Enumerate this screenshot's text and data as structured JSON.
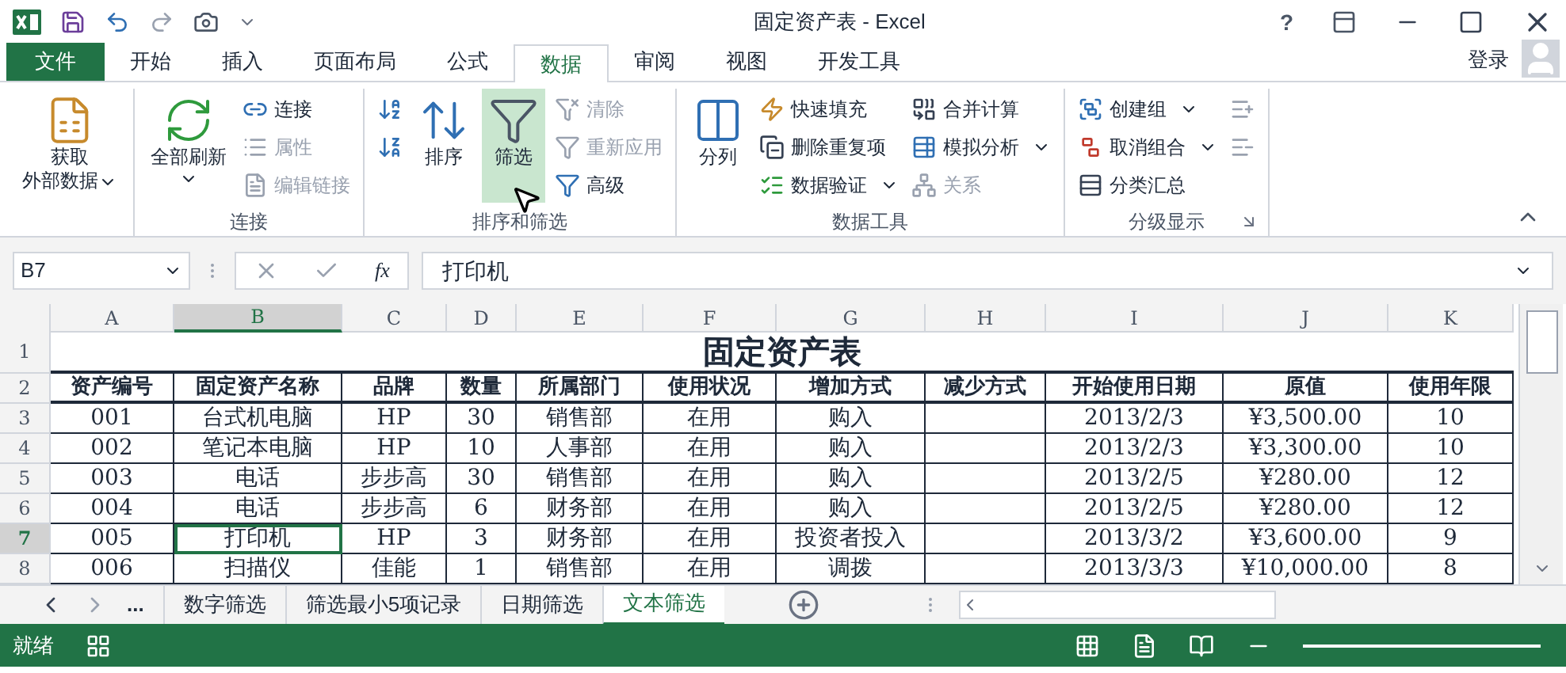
{
  "window": {
    "title": "固定资产表 - Excel",
    "help_label": "?"
  },
  "tabs": [
    {
      "label": "文件",
      "kind": "file",
      "selected": false
    },
    {
      "label": "开始",
      "kind": "tab",
      "selected": false
    },
    {
      "label": "插入",
      "kind": "tab",
      "selected": false
    },
    {
      "label": "页面布局",
      "kind": "tab",
      "selected": false
    },
    {
      "label": "公式",
      "kind": "tab",
      "selected": false
    },
    {
      "label": "数据",
      "kind": "tab",
      "selected": true
    },
    {
      "label": "审阅",
      "kind": "tab",
      "selected": false
    },
    {
      "label": "视图",
      "kind": "tab",
      "selected": false
    },
    {
      "label": "开发工具",
      "kind": "tab",
      "selected": false
    }
  ],
  "account": {
    "label": "登录"
  },
  "ribbon": {
    "groups": [
      {
        "columns": [
          {
            "kind": "large",
            "items": [
              {
                "lines": [
                  "获取",
                  "外部数据"
                ],
                "dropdown": true,
                "disabled": false,
                "highlighted": false
              }
            ]
          }
        ]
      },
      {
        "label": "连接",
        "columns": [
          {
            "kind": "large",
            "items": [
              {
                "lines": [
                  "全部刷新"
                ],
                "dropdown": true,
                "disabled": false,
                "highlighted": false
              }
            ]
          },
          {
            "kind": "stack",
            "items": [
              {
                "label": "连接",
                "dropdown": false,
                "disabled": false,
                "highlighted": false
              },
              {
                "label": "属性",
                "dropdown": false,
                "disabled": true,
                "highlighted": false
              },
              {
                "label": "编辑链接",
                "dropdown": false,
                "disabled": true,
                "highlighted": false
              }
            ]
          }
        ]
      },
      {
        "label": "排序和筛选",
        "columns": [
          {
            "kind": "stack",
            "items": [
              {
                "dropdown": false,
                "disabled": false,
                "highlighted": false
              },
              {
                "dropdown": false,
                "disabled": false,
                "highlighted": false
              }
            ]
          },
          {
            "kind": "large",
            "items": [
              {
                "lines": [
                  "排序"
                ],
                "dropdown": false,
                "disabled": false,
                "highlighted": false
              }
            ]
          },
          {
            "kind": "large",
            "items": [
              {
                "lines": [
                  "筛选"
                ],
                "dropdown": false,
                "disabled": false,
                "highlighted": true
              }
            ]
          },
          {
            "kind": "stack",
            "items": [
              {
                "label": "清除",
                "dropdown": false,
                "disabled": true,
                "highlighted": false
              },
              {
                "label": "重新应用",
                "dropdown": false,
                "disabled": true,
                "highlighted": false
              },
              {
                "label": "高级",
                "dropdown": false,
                "disabled": false,
                "highlighted": false
              }
            ]
          }
        ]
      },
      {
        "label": "数据工具",
        "columns": [
          {
            "kind": "large",
            "items": [
              {
                "lines": [
                  "分列"
                ],
                "dropdown": false,
                "disabled": false,
                "highlighted": false
              }
            ]
          },
          {
            "kind": "stack",
            "items": [
              {
                "label": "快速填充",
                "dropdown": false,
                "disabled": false,
                "highlighted": false
              },
              {
                "label": "删除重复项",
                "dropdown": false,
                "disabled": false,
                "highlighted": false
              },
              {
                "label": "数据验证",
                "dropdown": true,
                "disabled": false,
                "highlighted": false
              }
            ]
          },
          {
            "kind": "stack",
            "items": [
              {
                "label": "合并计算",
                "dropdown": false,
                "disabled": false,
                "highlighted": false
              },
              {
                "label": "模拟分析",
                "dropdown": true,
                "disabled": false,
                "highlighted": false
              },
              {
                "label": "关系",
                "dropdown": false,
                "disabled": true,
                "highlighted": false
              }
            ]
          }
        ]
      },
      {
        "label": "分级显示",
        "launcher": true,
        "columns": [
          {
            "kind": "stack",
            "items": [
              {
                "label": "创建组",
                "dropdown": true,
                "disabled": false,
                "highlighted": false
              },
              {
                "label": "取消组合",
                "dropdown": true,
                "disabled": false,
                "highlighted": false
              },
              {
                "label": "分类汇总",
                "dropdown": false,
                "disabled": false,
                "highlighted": false
              }
            ]
          },
          {
            "kind": "stack",
            "items": [
              {
                "dropdown": false,
                "disabled": true,
                "highlighted": false
              },
              {
                "dropdown": false,
                "disabled": true,
                "highlighted": false
              }
            ]
          }
        ]
      }
    ]
  },
  "formula_bar": {
    "name_box": "B7",
    "function_label": "fx",
    "value": "打印机"
  },
  "sheet": {
    "columns": [
      {
        "label": "A",
        "selected": false
      },
      {
        "label": "B",
        "selected": true
      },
      {
        "label": "C",
        "selected": false
      },
      {
        "label": "D",
        "selected": false
      },
      {
        "label": "E",
        "selected": false
      },
      {
        "label": "F",
        "selected": false
      },
      {
        "label": "G",
        "selected": false
      },
      {
        "label": "H",
        "selected": false
      },
      {
        "label": "I",
        "selected": false
      },
      {
        "label": "J",
        "selected": false
      },
      {
        "label": "K",
        "selected": false
      }
    ],
    "title_row": {
      "number": "1",
      "title": "固定资产表"
    },
    "header_row": {
      "number": "2",
      "cells": [
        "资产编号",
        "固定资产名称",
        "品牌",
        "数量",
        "所属部门",
        "使用状况",
        "增加方式",
        "减少方式",
        "开始使用日期",
        "原值",
        "使用年限"
      ]
    },
    "rows": [
      {
        "number": "3",
        "selected": false,
        "cells": [
          "001",
          "台式机电脑",
          "HP",
          "30",
          "销售部",
          "在用",
          "购入",
          "",
          "2013/2/3",
          "¥3,500.00",
          "10"
        ]
      },
      {
        "number": "4",
        "selected": false,
        "cells": [
          "002",
          "笔记本电脑",
          "HP",
          "10",
          "人事部",
          "在用",
          "购入",
          "",
          "2013/2/3",
          "¥3,300.00",
          "10"
        ]
      },
      {
        "number": "5",
        "selected": false,
        "cells": [
          "003",
          "电话",
          "步步高",
          "30",
          "销售部",
          "在用",
          "购入",
          "",
          "2013/2/5",
          "¥280.00",
          "12"
        ]
      },
      {
        "number": "6",
        "selected": false,
        "cells": [
          "004",
          "电话",
          "步步高",
          "6",
          "财务部",
          "在用",
          "购入",
          "",
          "2013/2/5",
          "¥280.00",
          "12"
        ]
      },
      {
        "number": "7",
        "selected": true,
        "cells": [
          "005",
          "打印机",
          "HP",
          "3",
          "财务部",
          "在用",
          "投资者投入",
          "",
          "2013/3/2",
          "¥3,600.00",
          "9"
        ]
      },
      {
        "number": "8",
        "selected": false,
        "cells": [
          "006",
          "扫描仪",
          "佳能",
          "1",
          "销售部",
          "在用",
          "调拨",
          "",
          "2013/3/3",
          "¥10,000.00",
          "8"
        ]
      }
    ]
  },
  "sheet_tabs": {
    "more_label": "...",
    "tabs": [
      {
        "label": "数字筛选",
        "selected": false
      },
      {
        "label": "筛选最小5项记录",
        "selected": false
      },
      {
        "label": "日期筛选",
        "selected": false
      },
      {
        "label": "文本筛选",
        "selected": true
      }
    ]
  },
  "status_bar": {
    "status": "就绪"
  }
}
